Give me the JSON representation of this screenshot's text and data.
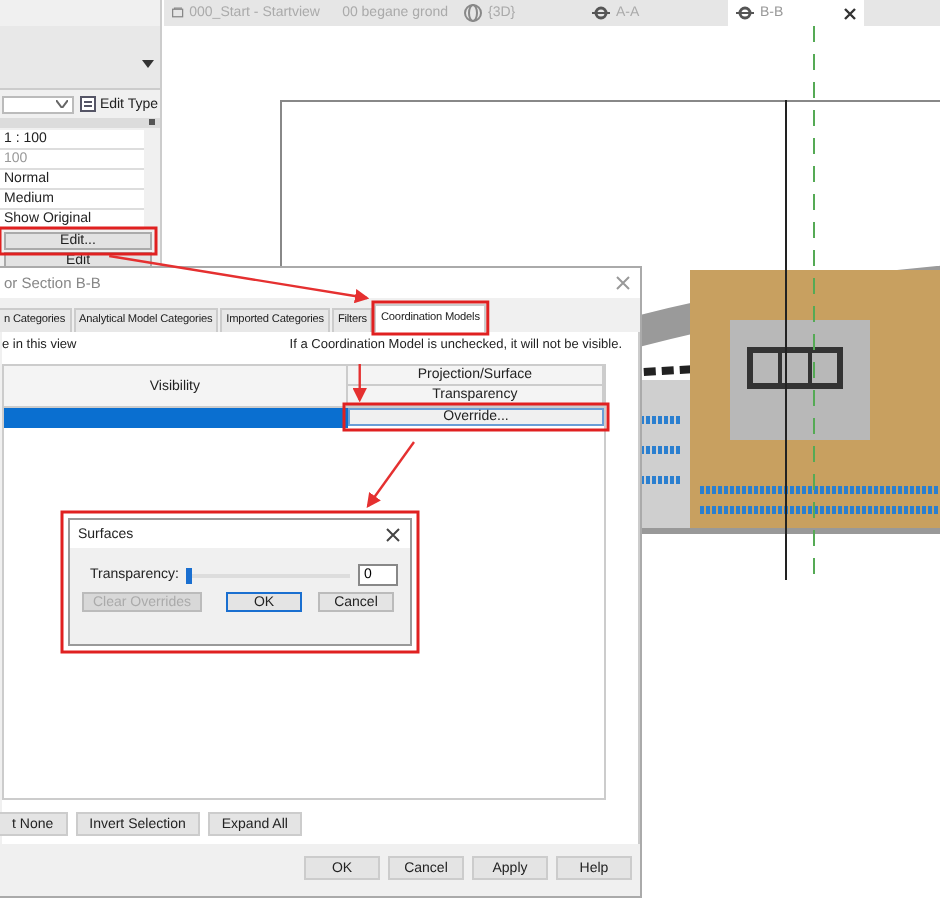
{
  "properties": {
    "edit_type": "Edit Type",
    "rows": [
      "1 : 100",
      "100",
      "Normal",
      "Medium",
      "Show Original"
    ],
    "edit_button": "Edit...",
    "edit_button_2": "Edit"
  },
  "view_tabs": [
    {
      "label": "000_Start - Startview",
      "kind": "sheet",
      "selected": false
    },
    {
      "label": "00 begane grond",
      "kind": "plan",
      "selected": false
    },
    {
      "label": "{3D}",
      "kind": "model",
      "selected": false
    },
    {
      "label": "A-A",
      "kind": "section",
      "selected": false
    },
    {
      "label": "B-B",
      "kind": "section",
      "selected": true
    }
  ],
  "dialog": {
    "title": "or Section B-B",
    "tabs": [
      {
        "label": "n Categories",
        "selected": false
      },
      {
        "label": "Analytical Model Categories",
        "selected": false
      },
      {
        "label": "Imported Categories",
        "selected": false
      },
      {
        "label": "Filters",
        "selected": false
      },
      {
        "label": "Coordination Models",
        "selected": true
      }
    ],
    "hint_left": "e in this view",
    "hint_right": "If a Coordination Model is unchecked, it will not be visible.",
    "columns": [
      "Visibility",
      "Projection/Surface",
      "Transparency"
    ],
    "rows": [
      {
        "selected": true,
        "override": "Override..."
      }
    ],
    "list_buttons": [
      "t None",
      "Invert Selection",
      "Expand All"
    ],
    "buttons": [
      "OK",
      "Cancel",
      "Apply",
      "Help"
    ]
  },
  "surfaces": {
    "title": "Surfaces",
    "label": "Transparency:",
    "level": 0,
    "value": "0",
    "buttons": [
      {
        "label": "Clear Overrides",
        "disabled": true,
        "default": false
      },
      {
        "label": "OK",
        "disabled": false,
        "default": true
      },
      {
        "label": "Cancel",
        "disabled": false,
        "default": false
      }
    ]
  }
}
